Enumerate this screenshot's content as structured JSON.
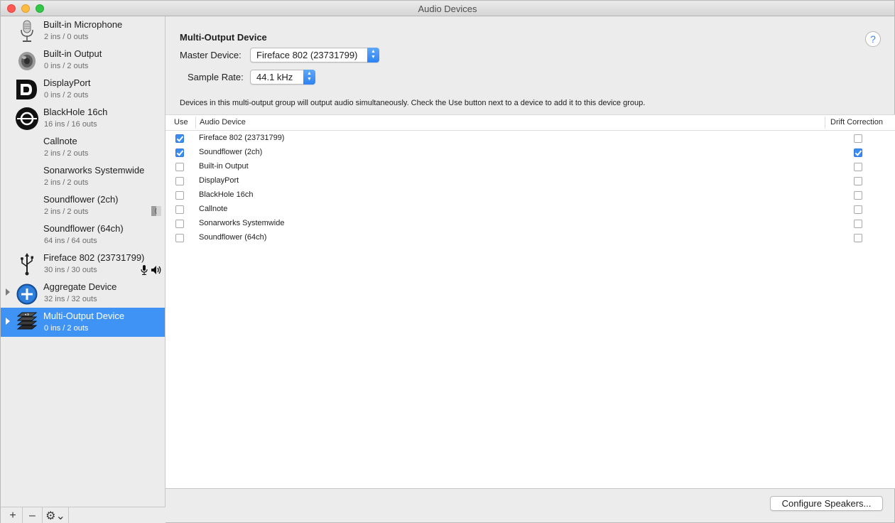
{
  "window": {
    "title": "Audio Devices"
  },
  "sidebar": {
    "devices": [
      {
        "name": "Built-in Microphone",
        "io": "2 ins / 0 outs",
        "icon": "microphone-icon"
      },
      {
        "name": "Built-in Output",
        "io": "0 ins / 2 outs",
        "icon": "speaker-icon"
      },
      {
        "name": "DisplayPort",
        "io": "0 ins / 2 outs",
        "icon": "displayport-icon"
      },
      {
        "name": "BlackHole 16ch",
        "io": "16 ins / 16 outs",
        "icon": "blackhole-icon"
      },
      {
        "name": "Callnote",
        "io": "2 ins / 2 outs",
        "icon": ""
      },
      {
        "name": "Sonarworks Systemwide",
        "io": "2 ins / 2 outs",
        "icon": ""
      },
      {
        "name": "Soundflower (2ch)",
        "io": "2 ins / 2 outs",
        "icon": ""
      },
      {
        "name": "Soundflower (64ch)",
        "io": "64 ins / 64 outs",
        "icon": ""
      },
      {
        "name": "Fireface 802 (23731799)",
        "io": "30 ins / 30 outs",
        "icon": "usb-icon"
      },
      {
        "name": "Aggregate Device",
        "io": "32 ins / 32 outs",
        "icon": "aggregate-plus-icon"
      },
      {
        "name": "Multi-Output Device",
        "io": "0 ins / 2 outs",
        "icon": "multi-output-icon",
        "selected": true
      }
    ],
    "add_label": "+",
    "remove_label": "–",
    "gear_label": "⚙⌄"
  },
  "main": {
    "title": "Multi-Output Device",
    "help_label": "?",
    "master_device_label": "Master Device:",
    "master_device_value": "Fireface 802 (23731799)",
    "sample_rate_label": "Sample Rate:",
    "sample_rate_value": "44.1 kHz",
    "description": "Devices in this multi-output group will output audio simultaneously. Check the Use button next to a device to add it to this device group.",
    "table": {
      "col_use": "Use",
      "col_device": "Audio Device",
      "col_drift": "Drift Correction",
      "rows": [
        {
          "device": "Fireface 802 (23731799)",
          "use": true,
          "drift": false
        },
        {
          "device": "Soundflower (2ch)",
          "use": true,
          "drift": true
        },
        {
          "device": "Built-in Output",
          "use": false,
          "drift": false
        },
        {
          "device": "DisplayPort",
          "use": false,
          "drift": false
        },
        {
          "device": "BlackHole 16ch",
          "use": false,
          "drift": false
        },
        {
          "device": "Callnote",
          "use": false,
          "drift": false
        },
        {
          "device": "Sonarworks Systemwide",
          "use": false,
          "drift": false
        },
        {
          "device": "Soundflower (64ch)",
          "use": false,
          "drift": false
        }
      ]
    },
    "configure_button": "Configure Speakers..."
  },
  "colors": {
    "selection": "#3f93f4",
    "checkbox_on": "#3b8cf3"
  }
}
